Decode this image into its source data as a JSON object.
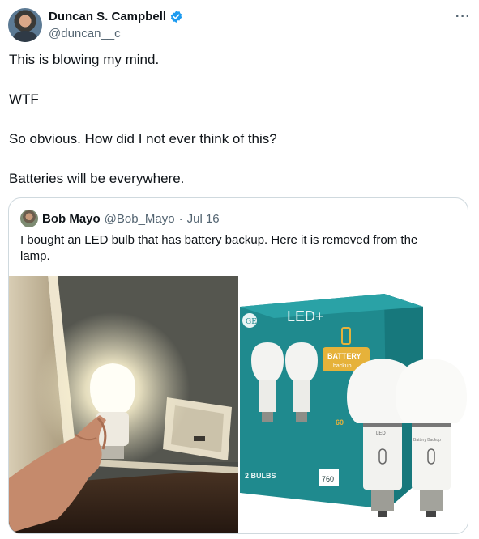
{
  "author": {
    "display_name": "Duncan S. Campbell",
    "handle": "@duncan__c",
    "verified_icon": "verified-badge-icon",
    "more_icon": "more-options-icon",
    "more_label": "···"
  },
  "tweet": {
    "lines": [
      "This is blowing my mind.",
      "WTF",
      "So obvious. How did I not ever think of this?",
      "Batteries will be everywhere."
    ]
  },
  "quote": {
    "display_name": "Bob Mayo",
    "handle": "@Bob_Mayo",
    "separator": "·",
    "date": "Jul 16",
    "text": "I bought an LED bulb that has battery backup. Here it is removed from the lamp."
  },
  "product_box": {
    "brand": "GE",
    "title": "LED+",
    "badge_line1": "BATTERY",
    "badge_line2": "backup",
    "bulb_count": "2 BULBS",
    "lumens": "760",
    "wattage": "60",
    "bulb_label": "LED",
    "bulb_sublabel": "Battery Backup"
  },
  "colors": {
    "accent": "#1d9bf0",
    "muted": "#536471",
    "box_teal": "#1f8a8e"
  }
}
